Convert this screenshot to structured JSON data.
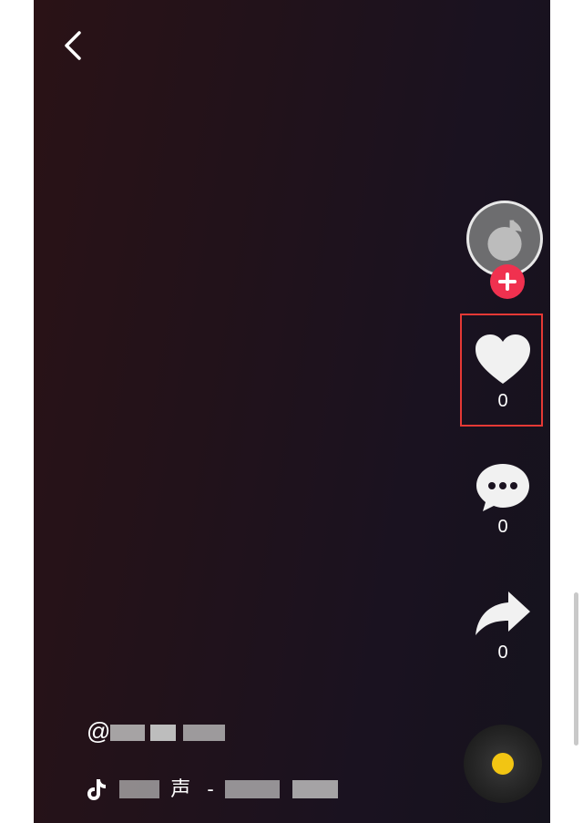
{
  "counts": {
    "likes": "0",
    "comments": "0",
    "shares": "0"
  },
  "author": {
    "prefix": "@"
  },
  "music": {
    "text_a": "声",
    "separator": "-"
  },
  "colors": {
    "highlight": "#e53935",
    "follow": "#f0314f",
    "disc_center": "#f2c513"
  },
  "icons": {
    "back": "chevron-left-icon",
    "like": "heart-icon",
    "comment": "speech-bubble-icon",
    "share": "share-arrow-icon",
    "music": "tiktok-note-icon",
    "follow": "plus-icon"
  }
}
